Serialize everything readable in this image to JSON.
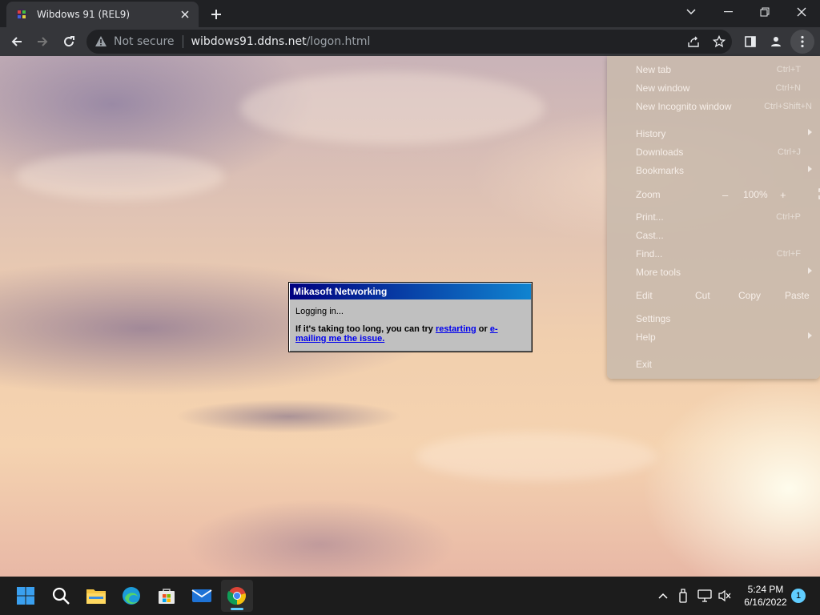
{
  "browser": {
    "tab": {
      "title": "Wibdows 91 (REL9)",
      "favicon": "wibdows-logo-icon"
    },
    "window_controls": [
      "chevron-down-icon",
      "minimize-icon",
      "restore-icon",
      "close-icon"
    ],
    "toolbar": {
      "security_label": "Not secure",
      "url_host": "wibdows91.ddns.net",
      "url_path": "/logon.html"
    }
  },
  "dialog": {
    "title": "Mikasoft Networking",
    "status": "Logging in...",
    "help_prefix": "If it's taking too long, you can try ",
    "link_restart": "restarting",
    "help_mid": " or ",
    "link_email": "e-mailing me the issue."
  },
  "menu": {
    "items": [
      {
        "label": "New tab",
        "shortcut": "Ctrl+T"
      },
      {
        "label": "New window",
        "shortcut": "Ctrl+N"
      },
      {
        "label": "New Incognito window",
        "shortcut": "Ctrl+Shift+N"
      },
      {
        "label": "History",
        "shortcut": ""
      },
      {
        "label": "Downloads",
        "shortcut": "Ctrl+J"
      },
      {
        "label": "Bookmarks",
        "shortcut": ""
      }
    ],
    "zoom": {
      "label": "Zoom",
      "minus": "–",
      "value": "100%",
      "plus": "+"
    },
    "items2": [
      {
        "label": "Print...",
        "shortcut": "Ctrl+P"
      },
      {
        "label": "Cast...",
        "shortcut": ""
      },
      {
        "label": "Find...",
        "shortcut": "Ctrl+F"
      },
      {
        "label": "More tools",
        "shortcut": ""
      }
    ],
    "edit": {
      "label": "Edit",
      "cut": "Cut",
      "copy": "Copy",
      "paste": "Paste"
    },
    "settings": "Settings",
    "help": "Help",
    "exit": "Exit"
  },
  "taskbar": {
    "apps": [
      "start-icon",
      "search-icon",
      "file-explorer-icon",
      "edge-icon",
      "store-icon",
      "mail-icon",
      "chrome-icon"
    ],
    "time": "5:24 PM",
    "date": "6/16/2022",
    "notification_count": "1"
  },
  "colors": {
    "titlebar": "#000080",
    "link": "#0000ee",
    "accent": "#60cdff"
  }
}
